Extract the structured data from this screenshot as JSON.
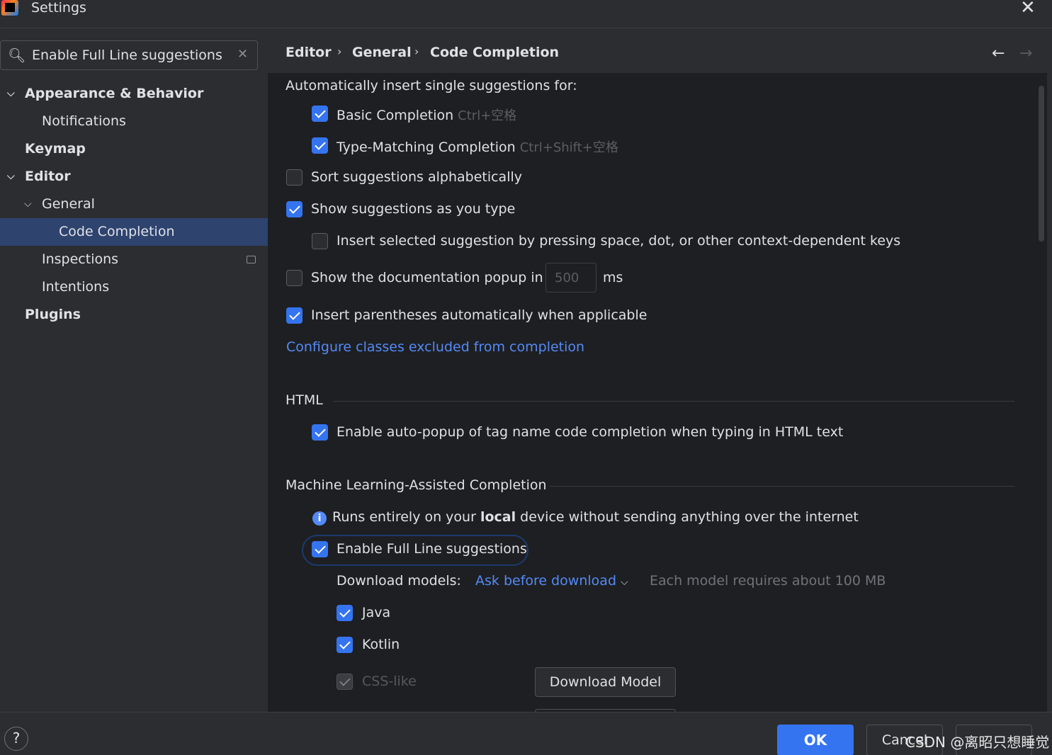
{
  "window": {
    "title": "Settings"
  },
  "search": {
    "value": "Enable Full Line suggestions"
  },
  "sidebar": {
    "items": [
      {
        "label": "Appearance & Behavior"
      },
      {
        "label": "Notifications"
      },
      {
        "label": "Keymap"
      },
      {
        "label": "Editor"
      },
      {
        "label": "General"
      },
      {
        "label": "Code Completion"
      },
      {
        "label": "Inspections"
      },
      {
        "label": "Intentions"
      },
      {
        "label": "Plugins"
      }
    ]
  },
  "breadcrumb": [
    "Editor",
    "General",
    "Code Completion"
  ],
  "completion": {
    "auto_insert_header": "Automatically insert single suggestions for:",
    "basic": {
      "label": "Basic Completion",
      "shortcut": "Ctrl+空格",
      "checked": true
    },
    "type_matching": {
      "label": "Type-Matching Completion",
      "shortcut": "Ctrl+Shift+空格",
      "checked": true
    },
    "sort_alpha": {
      "label": "Sort suggestions alphabetically",
      "checked": false
    },
    "show_as_type": {
      "label": "Show suggestions as you type",
      "checked": true
    },
    "insert_selected": {
      "label": "Insert selected suggestion by pressing space, dot, or other context-dependent keys",
      "checked": false
    },
    "doc_popup": {
      "label": "Show the documentation popup in",
      "value": "500",
      "unit": "ms",
      "checked": false
    },
    "parentheses": {
      "label": "Insert parentheses automatically when applicable",
      "checked": true
    },
    "configure_link": "Configure classes excluded from completion"
  },
  "html_section": {
    "title": "HTML",
    "auto_popup": {
      "label": "Enable auto-popup of tag name code completion when typing in HTML text",
      "checked": true
    }
  },
  "ml_section": {
    "title": "Machine Learning-Assisted Completion",
    "info_pre": "Runs entirely on your",
    "info_bold": "local",
    "info_post": "device without sending anything over the internet",
    "full_line": {
      "label": "Enable Full Line suggestions",
      "checked": true
    },
    "download_label": "Download models:",
    "download_option": "Ask before download",
    "download_note": "Each model requires about 100 MB",
    "languages": [
      {
        "label": "Java",
        "checked": true
      },
      {
        "label": "Kotlin",
        "checked": true
      },
      {
        "label": "CSS-like",
        "checked": true,
        "disabled": true
      }
    ],
    "download_button": "Download Model"
  },
  "footer": {
    "help": "?",
    "ok": "OK",
    "cancel": "Cancel",
    "watermark": "CSDN @离昭只想睡觉"
  },
  "colors": {
    "accent": "#3574f0",
    "link": "#548af7",
    "selection": "#2e436e",
    "background": "#1e1f22",
    "panel": "#2b2d30"
  }
}
